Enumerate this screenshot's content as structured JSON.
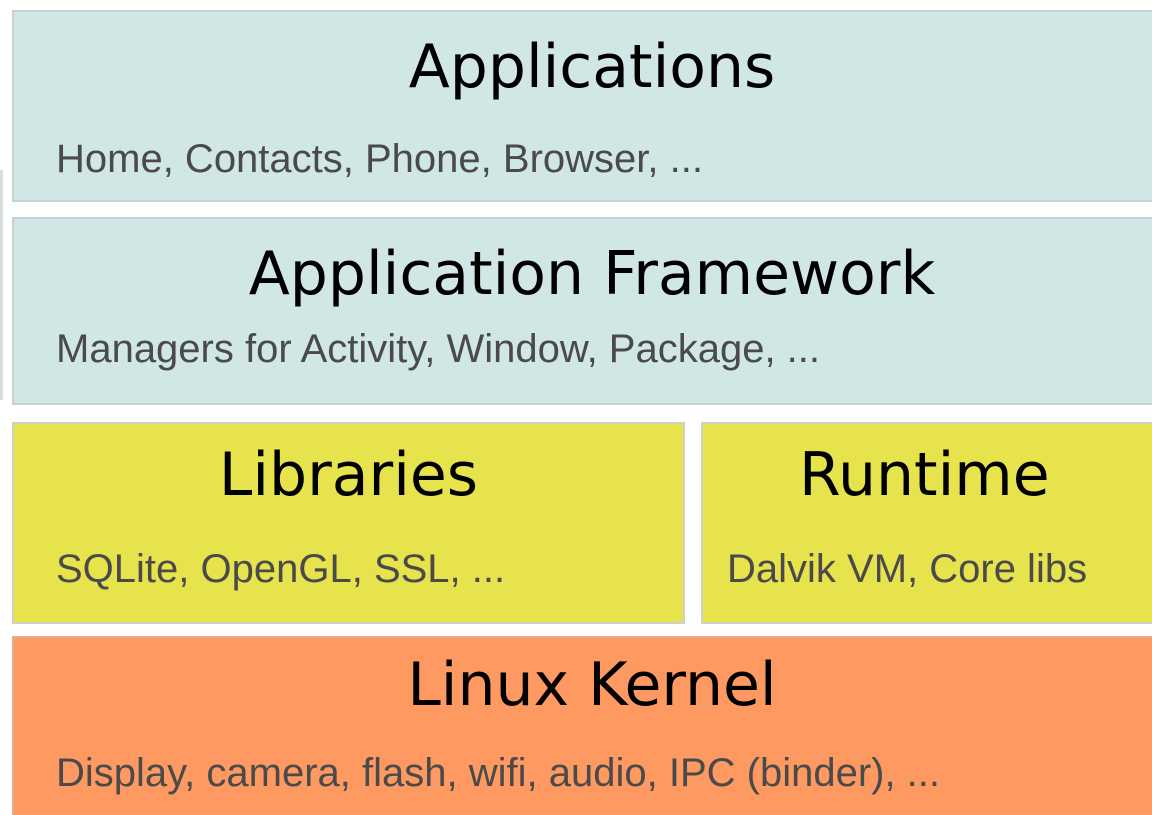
{
  "colors": {
    "upper_layer_fill": "#d1e7e5",
    "middle_layer_fill": "#e6e34d",
    "kernel_layer_fill": "#fd9961"
  },
  "layers": {
    "applications": {
      "title": "Applications",
      "description": "Home, Contacts, Phone, Browser, ..."
    },
    "framework": {
      "title": "Application Framework",
      "description": "Managers for Activity, Window, Package, ..."
    },
    "libraries": {
      "title": "Libraries",
      "description": "SQLite, OpenGL,  SSL, ..."
    },
    "runtime": {
      "title": "Runtime",
      "description": "Dalvik VM, Core libs"
    },
    "kernel": {
      "title": "Linux Kernel",
      "description": "Display, camera, flash, wifi, audio, IPC (binder), ..."
    }
  }
}
